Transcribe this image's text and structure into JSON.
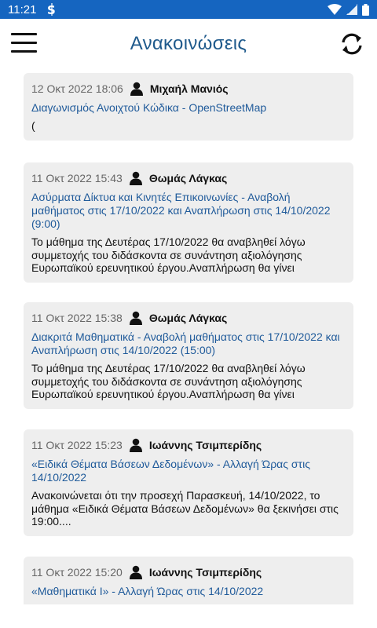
{
  "status": {
    "time": "11:21"
  },
  "header": {
    "title": "Ανακοινώσεις"
  },
  "announcements": [
    {
      "date": "12 Οκτ 2022 18:06",
      "author": "Μιχαήλ Μανιός",
      "title": "Διαγωνισμός Ανοιχτού Κώδικα - OpenStreetMap",
      "body": "("
    },
    {
      "date": "11 Οκτ 2022 15:43",
      "author": "Θωμάς Λάγκας",
      "title": "Ασύρματα Δίκτυα και Κινητές Επικοινωνίες - Αναβολή μαθήματος στις 17/10/2022 και Αναπλήρωση στις 14/10/2022 (9:00)",
      "body": "Το μάθημα της Δευτέρας 17/10/2022 θα αναβληθεί λόγω συμμετοχής του διδάσκοντα σε συνάντηση αξιολόγησης Ευρωπαϊκού ερευνητικού έργου.Αναπλήρωση θα γίνει"
    },
    {
      "date": "11 Οκτ 2022 15:38",
      "author": "Θωμάς Λάγκας",
      "title": "Διακριτά Μαθηματικά - Αναβολή μαθήματος στις 17/10/2022 και Αναπλήρωση στις 14/10/2022 (15:00)",
      "body": "Το μάθημα της Δευτέρας 17/10/2022 θα αναβληθεί λόγω συμμετοχής του διδάσκοντα σε συνάντηση αξιολόγησης Ευρωπαϊκού ερευνητικού έργου.Αναπλήρωση θα γίνει"
    },
    {
      "date": "11 Οκτ 2022 15:23",
      "author": "Ιωάννης Τσιμπερίδης",
      "title": "«Ειδικά Θέματα Βάσεων Δεδομένων» - Αλλαγή Ώρας στις 14/10/2022",
      "body": "Ανακοινώνεται ότι την προσεχή Παρασκευή, 14/10/2022, το μάθημα «Ειδικά Θέματα Βάσεων Δεδομένων» θα ξεκινήσει στις 19:00...."
    },
    {
      "date": "11 Οκτ 2022 15:20",
      "author": "Ιωάννης Τσιμπερίδης",
      "title": "«Μαθηματικά Ι» - Αλλαγή Ώρας στις 14/10/2022",
      "body": ""
    }
  ]
}
